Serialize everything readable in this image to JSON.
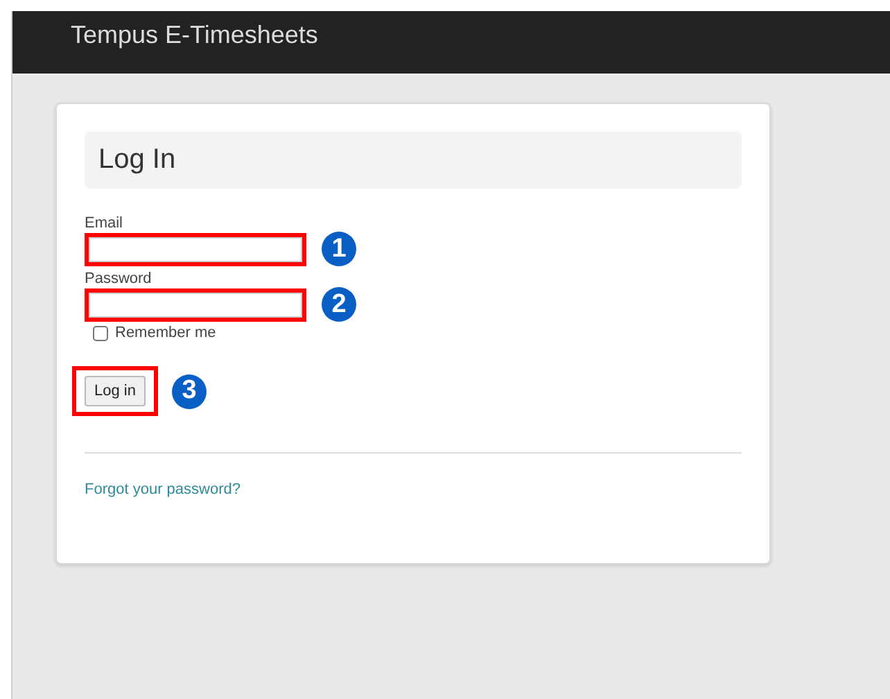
{
  "header": {
    "title": "Tempus E-Timesheets"
  },
  "login": {
    "title": "Log In",
    "fields": [
      {
        "label": "Email",
        "highlighted": true,
        "badge": "1"
      },
      {
        "label": "Password",
        "highlighted": true,
        "badge": "2"
      }
    ],
    "remember": {
      "label": "Remember me",
      "checked": false
    },
    "button": {
      "label": "Log in",
      "highlighted": true,
      "badge": "3"
    },
    "link": "Forgot your password?"
  }
}
